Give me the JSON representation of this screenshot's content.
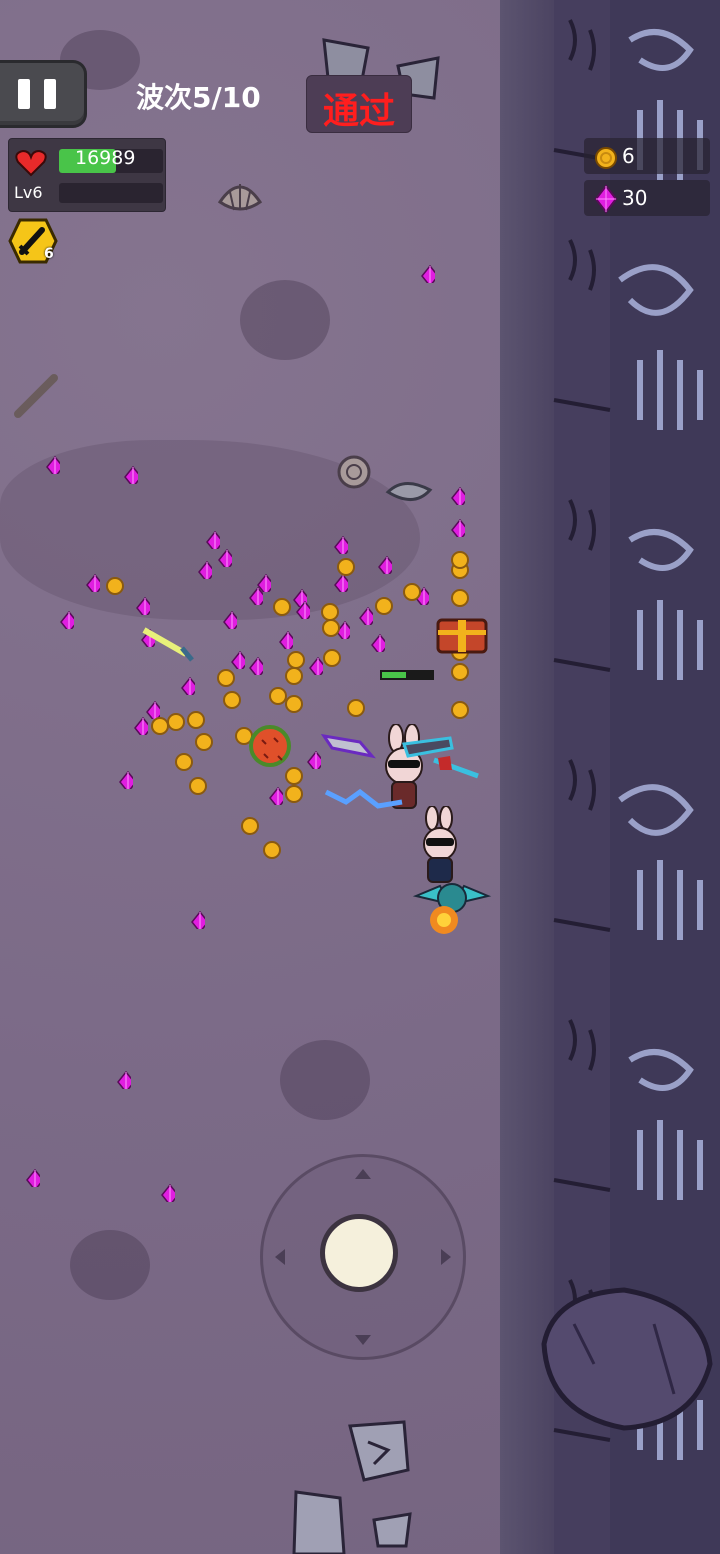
{
  "hud": {
    "wave_label": "波次5/10",
    "pass_label": "通过",
    "hp_value": "16989",
    "hp_fraction": 0.55,
    "level_label": "Lv6",
    "xp_fraction": 0.0,
    "weapon_count": "6",
    "coins": "6",
    "gems": "30"
  },
  "colors": {
    "hp": "#49c449",
    "pass_text": "#ff1e1e",
    "coin": "#f2b21c",
    "gem": "#e01ee0",
    "badge": "#f5c518"
  },
  "icons": {
    "pause": "pause-icon",
    "heart": "heart-icon",
    "sword": "sword-icon",
    "coin": "coin-icon",
    "gem": "gem-icon"
  }
}
